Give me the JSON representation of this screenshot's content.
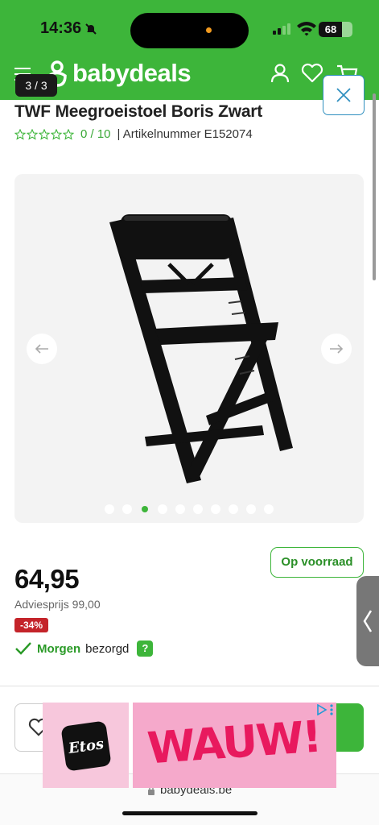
{
  "status_bar": {
    "time": "14:36",
    "battery": "68",
    "battery_level": 0.68
  },
  "header": {
    "logo_text": "babydeals",
    "image_counter": "3 / 3"
  },
  "product": {
    "title": "TWF Meegroeistoel Boris Zwart",
    "rating": "0 / 10",
    "rating_stars": 0,
    "sku": "| Artikelnummer E152074",
    "gallery": {
      "image_count": 10,
      "active_index": 2
    },
    "stock": "Op voorraad",
    "price": "64,95",
    "advice_price": "Adviesprijs 99,00",
    "discount": "-34%",
    "delivery_when": "Morgen",
    "delivery_text": "bezorgd",
    "help": "?"
  },
  "ad": {
    "brand": "Etos",
    "headline": "WAUW!"
  },
  "browser": {
    "url": "babydeals.be"
  },
  "colors": {
    "brand_green": "#3db53a",
    "discount_red": "#c4242a",
    "ad_pink": "#f5a9cb",
    "close_blue": "#2f8fbf"
  }
}
